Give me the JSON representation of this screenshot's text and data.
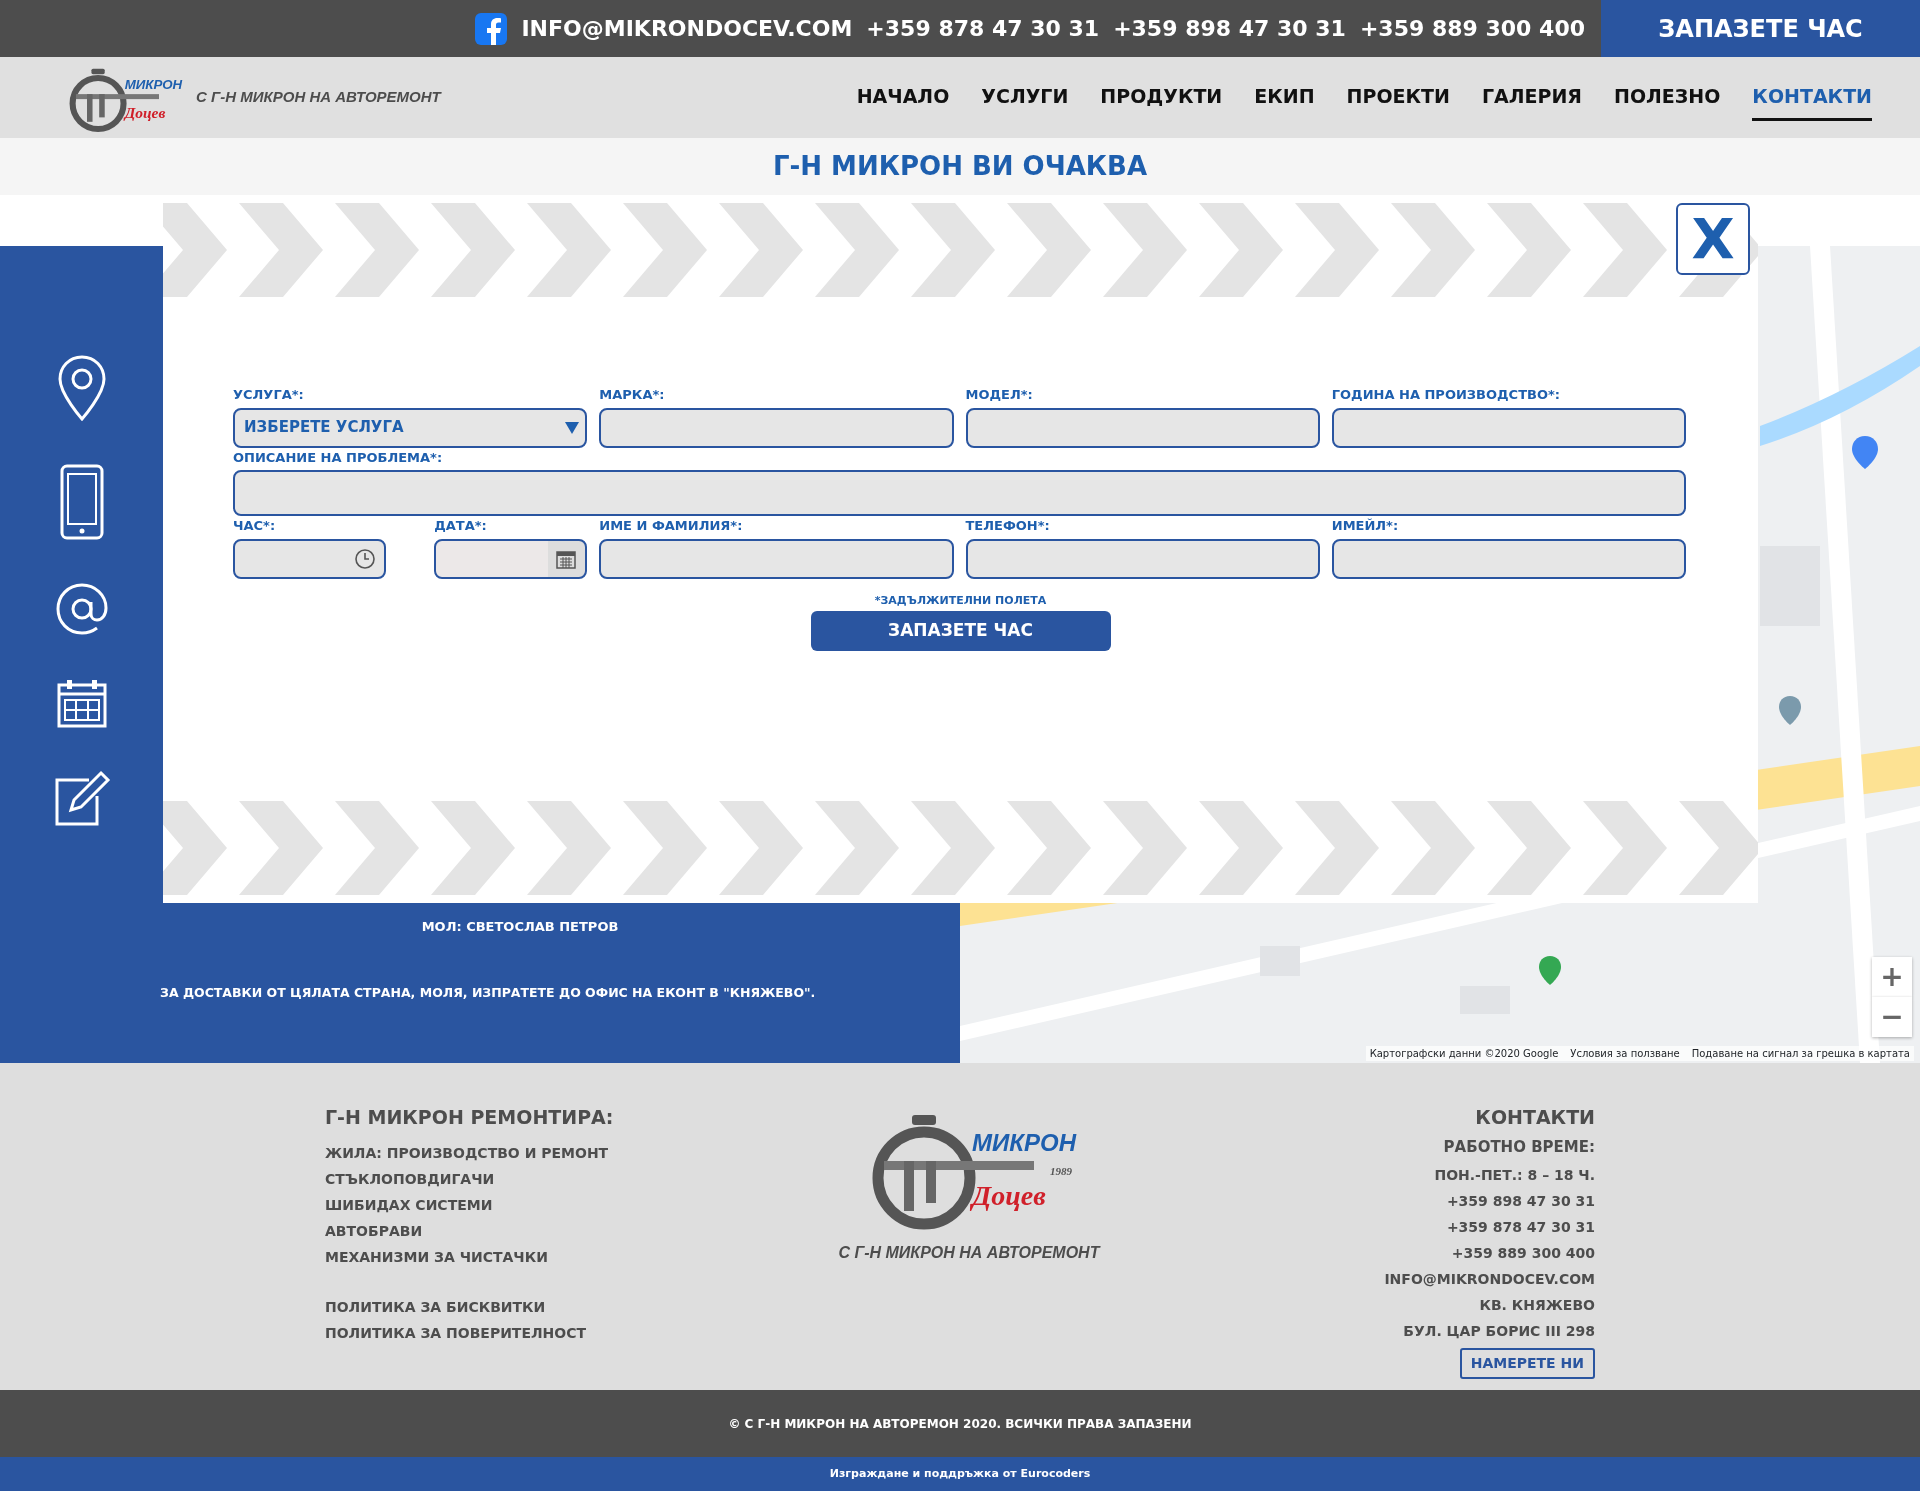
{
  "top_bar": {
    "email": "INFO@MIKRONDOCEV.COM",
    "phones": [
      "+359 878 47 30 31",
      "+359 898 47 30 31",
      "+359 889 300 400"
    ],
    "cta": "ЗАПАЗЕТЕ ЧАС"
  },
  "header": {
    "logo": {
      "name": "МИКРОН",
      "surname": "Доцев"
    },
    "tagline": "С Г-Н МИКРОН НА АВТОРЕМОНТ",
    "nav": [
      {
        "label": "НАЧАЛО",
        "selected": false
      },
      {
        "label": "УСЛУГИ",
        "selected": false
      },
      {
        "label": "ПРОДУКТИ",
        "selected": false
      },
      {
        "label": "ЕКИП",
        "selected": false
      },
      {
        "label": "ПРОЕКТИ",
        "selected": false
      },
      {
        "label": "ГАЛЕРИЯ",
        "selected": false
      },
      {
        "label": "ПОЛЕЗНО",
        "selected": false
      },
      {
        "label": "КОНТАКТИ",
        "selected": true
      }
    ]
  },
  "page_title": "Г-Н МИКРОН ВИ ОЧАКВА",
  "sidebar_icons": [
    {
      "kind": "pin"
    },
    {
      "kind": "phone"
    },
    {
      "kind": "at"
    },
    {
      "kind": "calendar"
    },
    {
      "kind": "edit"
    }
  ],
  "company": {
    "manager": "МОЛ: СВЕТОСЛАВ ПЕТРОВ",
    "delivery_note": "ЗА ДОСТАВКИ ОТ ЦЯЛАТА СТРАНА, МОЛЯ, ИЗПРАТЕТЕ ДО ОФИС НА ЕКОНТ В \"КНЯЖЕВО\"."
  },
  "map": {
    "kind": "picture",
    "zoom_buttons": [
      "+",
      "−"
    ],
    "attribution": [
      "Картографски данни ©2020 Google",
      "Условия за ползване",
      "Подаване на сигнал за грешка в картата"
    ]
  },
  "modal": {
    "close": "X",
    "fields": [
      {
        "label": "УСЛУГА*:",
        "kind": "select",
        "value": "ИЗБЕРЕТЕ УСЛУГА"
      },
      {
        "label": "МАРКА*:",
        "kind": "text"
      },
      {
        "label": "МОДЕЛ*:",
        "kind": "text"
      },
      {
        "label": "ГОДИНА НА ПРОИЗВОДСТВО*:",
        "kind": "text"
      },
      {
        "label": "ОПИСАНИЕ НА ПРОБЛЕМА*:",
        "kind": "textarea"
      },
      {
        "label": "ЧАС*:",
        "kind": "time"
      },
      {
        "label": "ДАТА*:",
        "kind": "date"
      },
      {
        "label": "ИМЕ И ФАМИЛИЯ*:",
        "kind": "text"
      },
      {
        "label": "ТЕЛЕФОН*:",
        "kind": "text"
      },
      {
        "label": "ИМЕЙЛ*:",
        "kind": "text"
      }
    ],
    "required_note": "*ЗАДЪЛЖИТЕЛНИ ПОЛЕТА",
    "submit": "ЗАПАЗЕТЕ ЧАС"
  },
  "footer": {
    "left": {
      "heading": "Г-Н МИКРОН РЕМОНТИРА:",
      "services": [
        "ЖИЛА: ПРОИЗВОДСТВО И РЕМОНТ",
        "СТЪКЛОПОВДИГАЧИ",
        "ШИБИДАХ СИСТЕМИ",
        "АВТОБРАВИ",
        "МЕХАНИЗМИ ЗА ЧИСТАЧКИ"
      ],
      "policies": [
        "ПОЛИТИКА ЗА БИСКВИТКИ",
        "ПОЛИТИКА ЗА ПОВЕРИТЕЛНОСТ"
      ]
    },
    "logo": {
      "name": "МИКРОН",
      "surname": "Доцев",
      "year": "1989"
    },
    "tagline": "С Г-Н МИКРОН НА АВТОРЕМОНТ",
    "contacts": {
      "heading": "КОНТАКТИ",
      "hours_label": "РАБОТНО ВРЕМЕ:",
      "lines": [
        "ПОН.-ПЕТ.: 8 – 18 Ч.",
        "+359 898 47 30 31",
        "+359 878 47 30 31",
        "+359 889 300 400",
        "INFO@MIKRONDOCEV.COM",
        "КВ. КНЯЖЕВО",
        "БУЛ. ЦАР БОРИС III 298"
      ],
      "button": "НАМЕРЕТЕ НИ"
    }
  },
  "copyright": "© С Г-Н МИКРОН НА АВТОРЕМОН 2020. ВСИЧКИ ПРАВА ЗАПАЗЕНИ",
  "credit": "Изграждане и поддръжка от Eurocoders"
}
